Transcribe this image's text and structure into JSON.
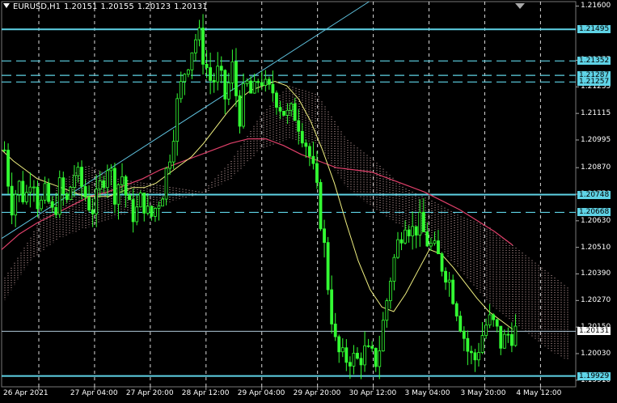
{
  "header": {
    "symbol": "EURUSD,H1",
    "open": "1.20151",
    "high": "1.20155",
    "low": "1.20123",
    "close": "1.20131"
  },
  "colors": {
    "background": "#000000",
    "bull_candle": "#33ff33",
    "bear_candle": "#33ff33",
    "level_line": "#5fd3e6",
    "ma_slow": "#e0406a",
    "ma_fast": "#f0f080",
    "trendline": "#5fc3e0",
    "cloud_dots": "#f4c7c7",
    "grid": "#ffffff",
    "current_price_line": "#b0c8d8",
    "axis_text": "#ffffff"
  },
  "price_axis": {
    "ticks": [
      "1.21600",
      "1.21355",
      "1.21235",
      "1.21115",
      "1.20995",
      "1.20870",
      "1.20750",
      "1.20630",
      "1.20510",
      "1.20390",
      "1.20270",
      "1.20150",
      "1.20030",
      "1.19910"
    ]
  },
  "levels": [
    {
      "value": "1.21495",
      "style": "solid"
    },
    {
      "value": "1.21352",
      "style": "dashed"
    },
    {
      "value": "1.21287",
      "style": "dashed"
    },
    {
      "value": "1.21257",
      "style": "dashed"
    },
    {
      "value": "1.20748",
      "style": "solid"
    },
    {
      "value": "1.20668",
      "style": "dashed"
    },
    {
      "value": "1.19929",
      "style": "solid"
    }
  ],
  "current_price": "1.20131",
  "time_axis": {
    "labels": [
      "26 Apr 2021",
      "27 Apr 04:00",
      "27 Apr 20:00",
      "28 Apr 12:00",
      "29 Apr 04:00",
      "29 Apr 20:00",
      "30 Apr 12:00",
      "3 May 04:00",
      "3 May 20:00",
      "4 May 12:00"
    ]
  },
  "chart_data": {
    "type": "candlestick",
    "symbol": "EURUSD",
    "timeframe": "H1",
    "ylim": [
      1.1988,
      1.2162
    ],
    "x_labels": [
      "26 Apr 2021",
      "27 Apr 04:00",
      "27 Apr 20:00",
      "28 Apr 12:00",
      "29 Apr 04:00",
      "29 Apr 20:00",
      "30 Apr 12:00",
      "3 May 04:00",
      "3 May 20:00",
      "4 May 12:00"
    ],
    "close_path": [
      1.2095,
      1.207,
      1.208,
      1.2072,
      1.2088,
      1.2068,
      1.2075,
      1.2065,
      1.2078,
      1.207,
      1.2085,
      1.208,
      1.2072,
      1.2068,
      1.208,
      1.209,
      1.2076,
      1.2084,
      1.2068,
      1.2066,
      1.2074,
      1.2063,
      1.207,
      1.2078,
      1.2095,
      1.2115,
      1.213,
      1.214,
      1.2148,
      1.2135,
      1.2125,
      1.213,
      1.2118,
      1.2132,
      1.211,
      1.2125,
      1.2118,
      1.213,
      1.212,
      1.2122,
      1.2115,
      1.211,
      1.2112,
      1.2105,
      1.2095,
      1.208,
      1.206,
      1.203,
      1.2005,
      1.2,
      1.2002,
      1.1999,
      1.2004,
      1.2001,
      1.2,
      1.202,
      1.204,
      1.2053,
      1.2065,
      1.2058,
      1.2062,
      1.2055,
      1.205,
      1.2045,
      1.204,
      1.203,
      1.2018,
      1.2005,
      1.1999,
      1.201,
      1.2018,
      1.2015,
      1.2007,
      1.2012,
      1.2013
    ],
    "ma_fast": [
      1.2095,
      1.209,
      1.2086,
      1.2082,
      1.208,
      1.2078,
      1.2076,
      1.2074,
      1.2074,
      1.2074,
      1.2076,
      1.2078,
      1.2078,
      1.208,
      1.2084,
      1.2088,
      1.2092,
      1.2098,
      1.2105,
      1.2112,
      1.2118,
      1.2122,
      1.2124,
      1.2126,
      1.2124,
      1.2118,
      1.2108,
      1.2095,
      1.208,
      1.2062,
      1.2045,
      1.2032,
      1.2024,
      1.2022,
      1.203,
      1.204,
      1.205,
      1.2048,
      1.2042,
      1.2035,
      1.2028,
      1.2022,
      1.2018,
      1.2014
    ],
    "ma_slow": [
      1.205,
      1.2057,
      1.2062,
      1.2066,
      1.207,
      1.2074,
      1.2076,
      1.2079,
      1.2082,
      1.2086,
      1.2089,
      1.2092,
      1.2095,
      1.2098,
      1.21,
      1.21,
      1.2097,
      1.2093,
      1.209,
      1.2087,
      1.2086,
      1.2085,
      1.2082,
      1.2079,
      1.2076,
      1.2072,
      1.2068,
      1.2063,
      1.2058,
      1.2052
    ],
    "ichimoku_cloud": {
      "top": [
        1.2035,
        1.2055,
        1.208,
        1.2088,
        1.2082,
        1.208,
        1.2078,
        1.2076,
        1.209,
        1.211,
        1.2124,
        1.212,
        1.21,
        1.209,
        1.2078,
        1.2072,
        1.2065,
        1.206,
        1.205,
        1.204,
        1.203
      ],
      "bottom": [
        1.2025,
        1.2045,
        1.2055,
        1.206,
        1.2065,
        1.2068,
        1.2072,
        1.2075,
        1.2082,
        1.2095,
        1.21,
        1.2098,
        1.2078,
        1.2068,
        1.206,
        1.2055,
        1.204,
        1.2025,
        1.2015,
        1.2005,
        1.1998
      ]
    },
    "trendline": {
      "from": [
        0,
        1.2055
      ],
      "to": [
        0.64,
        1.2162
      ]
    }
  }
}
